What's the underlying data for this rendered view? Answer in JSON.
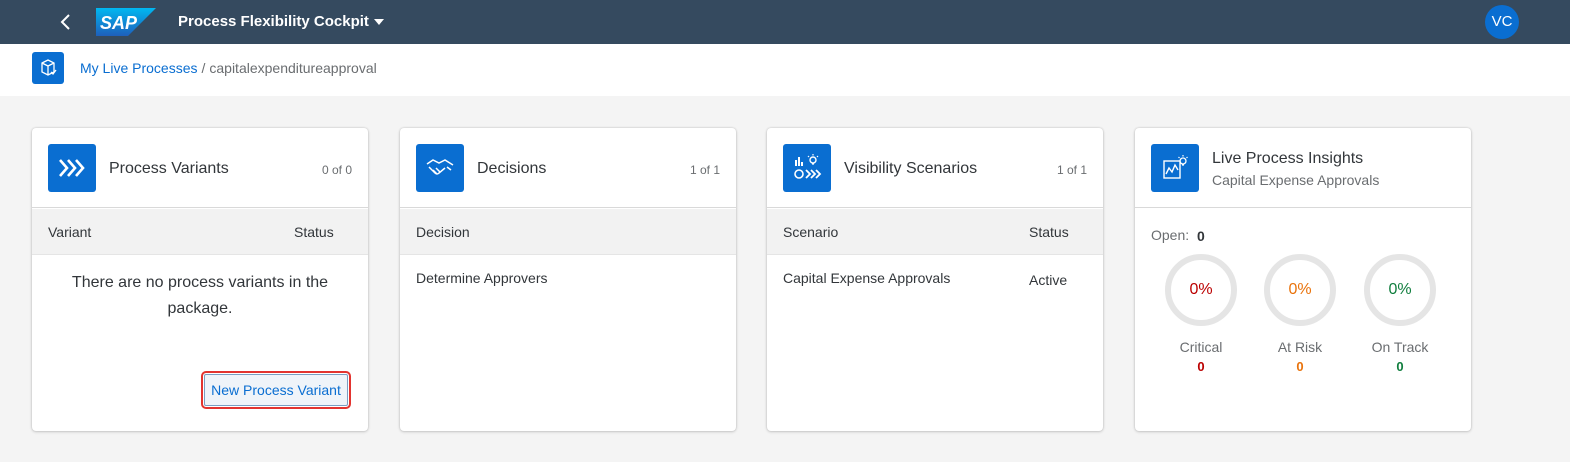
{
  "shell": {
    "logo_text": "SAP",
    "app_title": "Process Flexibility Cockpit",
    "avatar_initials": "VC"
  },
  "breadcrumb": {
    "link": "My Live Processes",
    "separator": "/",
    "current": "capitalexpenditureapproval"
  },
  "cards": {
    "variants": {
      "title": "Process Variants",
      "count": "0 of 0",
      "columns": [
        "Variant",
        "Status"
      ],
      "empty_message": "There are no process variants in the package.",
      "new_button": "New Process Variant"
    },
    "decisions": {
      "title": "Decisions",
      "count": "1 of 1",
      "columns": [
        "Decision"
      ],
      "rows": [
        {
          "decision": "Determine Approvers"
        }
      ]
    },
    "scenarios": {
      "title": "Visibility Scenarios",
      "count": "1 of 1",
      "columns": [
        "Scenario",
        "Status"
      ],
      "rows": [
        {
          "scenario": "Capital Expense Approvals",
          "status": "Active"
        }
      ]
    },
    "insights": {
      "title": "Live Process Insights",
      "subtitle": "Capital Expense Approvals",
      "open_label": "Open:",
      "open_value": "0",
      "kpis": [
        {
          "percent": "0%",
          "label": "Critical",
          "value": "0",
          "color": "#bb0000"
        },
        {
          "percent": "0%",
          "label": "At Risk",
          "value": "0",
          "color": "#e9730c"
        },
        {
          "percent": "0%",
          "label": "On Track",
          "value": "0",
          "color": "#107e3e"
        }
      ]
    }
  },
  "colors": {
    "shell_bg": "#354a5f",
    "accent": "#0a6ed1",
    "page_bg": "#f4f4f4",
    "highlight": "#e3342f"
  }
}
